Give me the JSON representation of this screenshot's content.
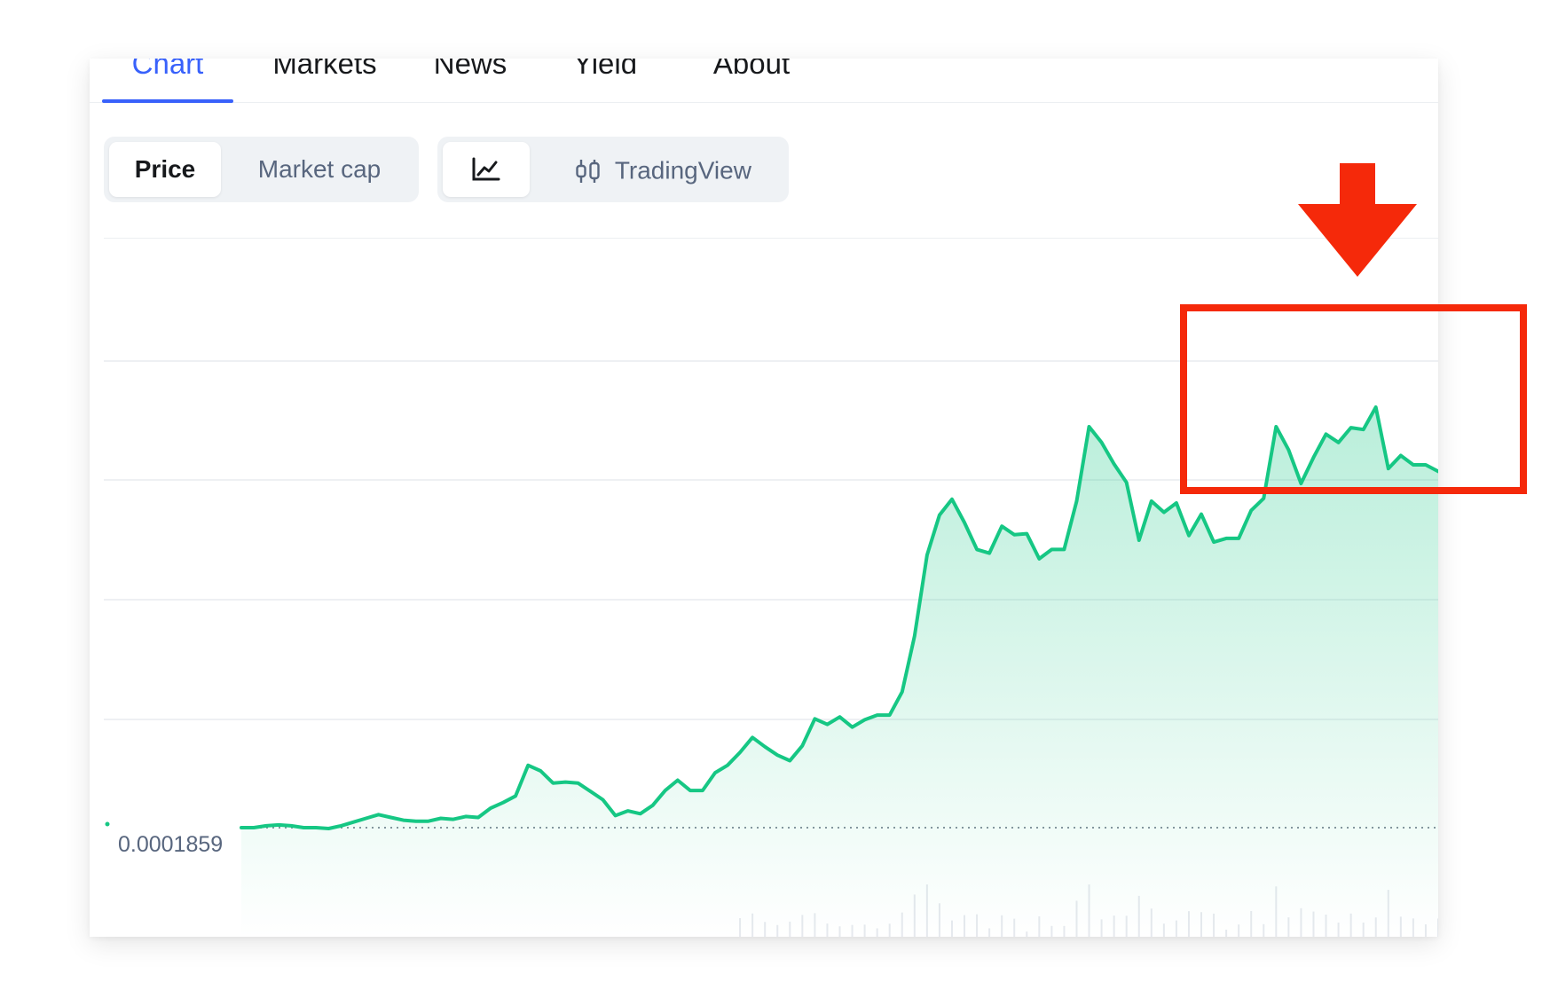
{
  "tabs": [
    {
      "label": "Chart",
      "active": true
    },
    {
      "label": "Markets",
      "active": false
    },
    {
      "label": "News",
      "active": false
    },
    {
      "label": "Yield",
      "active": false
    },
    {
      "label": "About",
      "active": false
    }
  ],
  "toolbar": {
    "price_label": "Price",
    "market_cap_label": "Market cap",
    "line_chart_icon": "line-chart-icon",
    "candlestick_icon": "candlestick-icon",
    "tradingview_label": "TradingView"
  },
  "colors": {
    "accent": "#3861fb",
    "line": "#16c784",
    "annotation": "#f5290a"
  },
  "chart_data": {
    "type": "area",
    "baseline_label": "0.0001859",
    "y": [
      0.0001859,
      0.0001859,
      0.0001861,
      0.0001862,
      0.0001861,
      0.0001859,
      0.0001859,
      0.0001858,
      0.0001861,
      0.0001865,
      0.0001869,
      0.0001873,
      0.000187,
      0.0001867,
      0.0001866,
      0.0001866,
      0.0001869,
      0.0001868,
      0.0001871,
      0.000187,
      0.000188,
      0.0001886,
      0.0001893,
      0.0001926,
      0.000192,
      0.0001907,
      0.0001908,
      0.0001907,
      0.0001898,
      0.0001889,
      0.0001872,
      0.0001877,
      0.0001874,
      0.0001883,
      0.0001899,
      0.000191,
      0.0001899,
      0.0001899,
      0.0001918,
      0.0001926,
      0.000194,
      0.0001956,
      0.0001946,
      0.0001937,
      0.0001931,
      0.0001947,
      0.0001976,
      0.000197,
      0.0001978,
      0.0001967,
      0.0001975,
      0.000198,
      0.000198,
      0.0002005,
      0.0002065,
      0.0002152,
      0.0002195,
      0.0002212,
      0.0002187,
      0.0002158,
      0.0002154,
      0.0002183,
      0.0002174,
      0.0002175,
      0.0002148,
      0.0002158,
      0.0002158,
      0.000221,
      0.000229,
      0.0002273,
      0.000225,
      0.000223,
      0.0002168,
      0.000221,
      0.0002198,
      0.0002208,
      0.0002173,
      0.0002196,
      0.0002166,
      0.000217,
      0.000217,
      0.00022,
      0.0002213,
      0.000229,
      0.0002265,
      0.0002229,
      0.0002257,
      0.0002282,
      0.0002273,
      0.0002289,
      0.0002287,
      0.0002311,
      0.0002245,
      0.0002259,
      0.0002249,
      0.0002249,
      0.0002242
    ],
    "x_range": [
      0,
      96
    ],
    "grid": true
  }
}
